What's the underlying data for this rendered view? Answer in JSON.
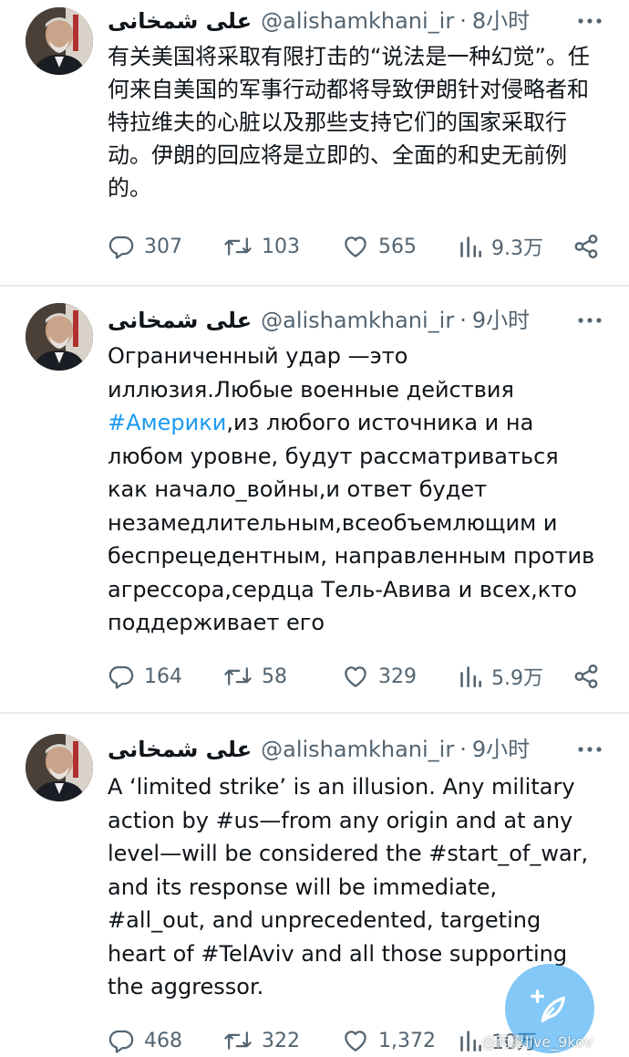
{
  "tweets": [
    {
      "name": "علی شمخانی",
      "handle": "@alishamkhani_ir",
      "separator": "·",
      "time": "8小时",
      "text": "有关美国将采取有限打击的“说法是一种幻觉”。任何来自美国的军事行动都将导致伊朗针对侵略者和特拉维夫的心脏以及那些支持它们的国家采取行动。伊朗的回应将是立即的、全面的和史无前例的。",
      "replies": "307",
      "retweets": "103",
      "likes": "565",
      "views": "9.3万"
    },
    {
      "name": "علی شمخانی",
      "handle": "@alishamkhani_ir",
      "separator": "·",
      "time": "9小时",
      "text_parts": {
        "before": "Ограниченный удар —это иллюзия.Любые военные действия ",
        "hashtag": "#Америки",
        "after": ",из любого источника и на любом уровне, будут рассматриваться как начало_войны,и ответ будет незамедлительным,всеобъемлющим и беспрецедентным, направленным против агрессора,сердца Тель-Авива и всех,кто поддерживает его"
      },
      "replies": "164",
      "retweets": "58",
      "likes": "329",
      "views": "5.9万"
    },
    {
      "name": "علی شمخانی",
      "handle": "@alishamkhani_ir",
      "separator": "·",
      "time": "9小时",
      "text": "A ‘limited strike’ is an illusion. Any military action by #us—from any origin and at any level—will be considered the #start_of_war, and its response will be immediate, #all_out, and unprecedented, targeting heart of #TelAviv and all those supporting the aggressor.",
      "replies": "468",
      "retweets": "322",
      "likes": "1,372",
      "views": "10万"
    }
  ],
  "watermark": "@丙嘉live_9kov",
  "icons": {
    "reply": "reply-icon",
    "retweet": "retweet-icon",
    "like": "heart-icon",
    "views": "views-icon",
    "share": "share-icon",
    "more": "more-icon",
    "compose": "compose-icon"
  },
  "colors": {
    "hashtag": "#1d9bf0",
    "secondary": "#536471",
    "fab": "#1d9bf0"
  }
}
